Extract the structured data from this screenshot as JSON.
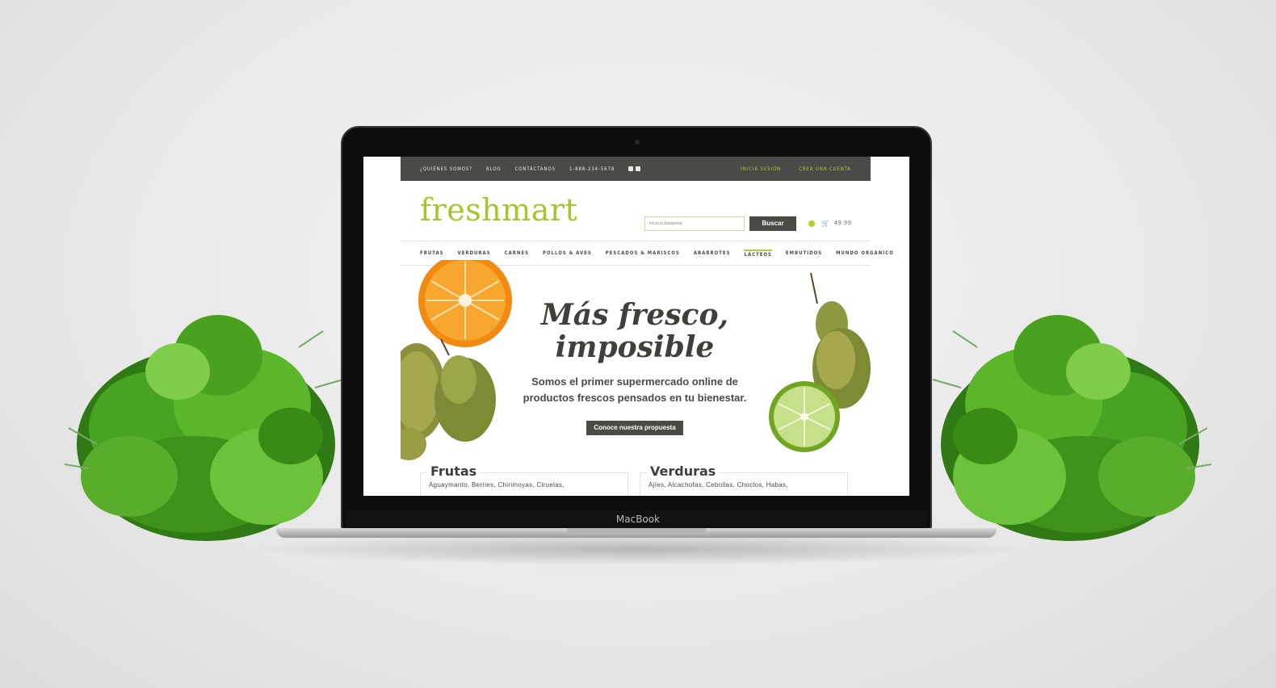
{
  "topbar": {
    "links": [
      "¿QUIÉNES SOMOS?",
      "BLOG",
      "CONTÁCTANOS",
      "1-888-234-5678"
    ],
    "login": "INICIA SESIÓN",
    "register": "CREA UNA CUENTA"
  },
  "header": {
    "logo": "freshmart",
    "search_placeholder": "Inicia tu búsqueda",
    "search_button": "Buscar",
    "cart_total": "49.99"
  },
  "nav": {
    "items": [
      "FRUTAS",
      "VERDURAS",
      "CARNES",
      "POLLOS & AVES",
      "PESCADOS & MARISCOS",
      "ABARROTES",
      "LÁCTEOS",
      "EMBUTIDOS",
      "MUNDO ORGÁNICO"
    ],
    "active": "LÁCTEOS"
  },
  "hero": {
    "title_line1": "Más fresco,",
    "title_line2": "imposible",
    "subtitle_line1": "Somos el primer supermercado online de",
    "subtitle_line2": "productos frescos pensados en tu bienestar.",
    "cta": "Conoce nuestra propuesta"
  },
  "categories": [
    {
      "title": "Frutas",
      "items": "Aguaymanto, Berries, Chirimoyas, Ciruelas,"
    },
    {
      "title": "Verduras",
      "items": "Ajíes, Alcachofas, Cebollas, Choclos, Habas,"
    }
  ],
  "laptop": {
    "brand": "MacBook"
  },
  "colors": {
    "accent": "#b7cc2f",
    "dark": "#4a4a46",
    "leaf": "#3d8f1f"
  }
}
